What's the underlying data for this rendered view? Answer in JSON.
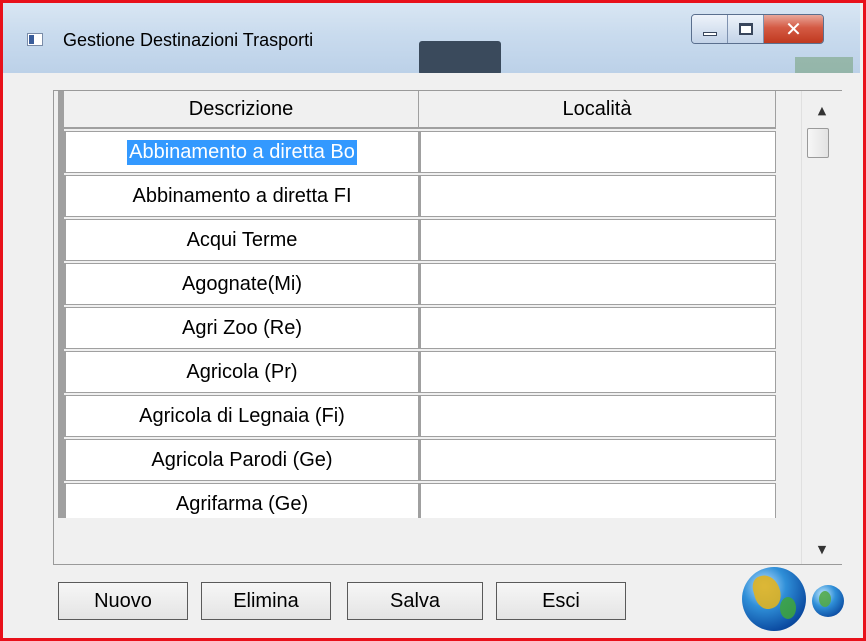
{
  "window": {
    "title": "Gestione Destinazioni Trasporti",
    "controls": {
      "minimize_icon": "minimize-icon",
      "maximize_icon": "maximize-icon",
      "close_icon": "close-icon"
    }
  },
  "grid": {
    "columns": [
      "Descrizione",
      "Località"
    ],
    "rows": [
      {
        "descrizione": "Abbinamento a diretta Bo",
        "localita": ""
      },
      {
        "descrizione": "Abbinamento a diretta FI",
        "localita": ""
      },
      {
        "descrizione": "Acqui Terme",
        "localita": ""
      },
      {
        "descrizione": "Agognate(Mi)",
        "localita": ""
      },
      {
        "descrizione": "Agri Zoo (Re)",
        "localita": ""
      },
      {
        "descrizione": "Agricola (Pr)",
        "localita": ""
      },
      {
        "descrizione": "Agricola di Legnaia (Fi)",
        "localita": ""
      },
      {
        "descrizione": "Agricola Parodi (Ge)",
        "localita": ""
      },
      {
        "descrizione": "Agrifarma (Ge)",
        "localita": ""
      }
    ],
    "selected_row": 0,
    "scroll": {
      "up_icon": "scroll-up-arrow-icon",
      "down_icon": "scroll-down-arrow-icon"
    }
  },
  "buttons": {
    "nuovo": "Nuovo",
    "elimina": "Elimina",
    "salva": "Salva",
    "esci": "Esci"
  },
  "logo": {
    "icon": "globe-icon"
  },
  "colors": {
    "selection": "#3399ff",
    "frame_border": "#e8101a",
    "close_button": "#c0391f"
  }
}
